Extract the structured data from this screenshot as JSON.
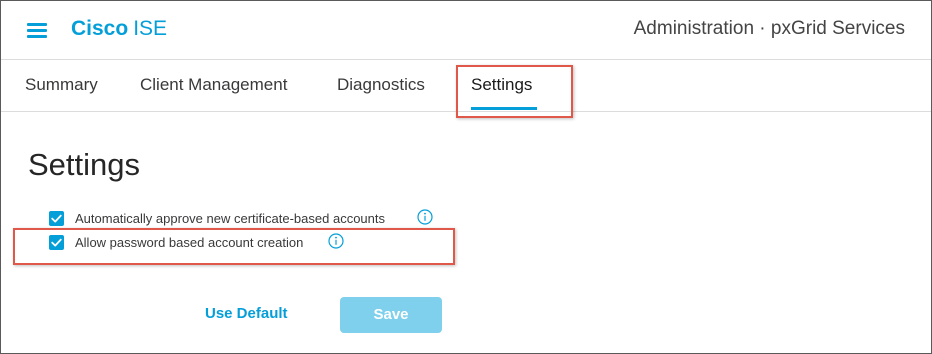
{
  "header": {
    "brand_strong": "Cisco",
    "brand_light": "ISE",
    "title": "Administration · pxGrid Services"
  },
  "tabs": [
    {
      "label": "Summary",
      "active": false
    },
    {
      "label": "Client Management",
      "active": false
    },
    {
      "label": "Diagnostics",
      "active": false
    },
    {
      "label": "Settings",
      "active": true
    }
  ],
  "settings": {
    "title": "Settings",
    "options": [
      {
        "label": "Automatically approve new certificate-based accounts",
        "checked": true,
        "icon": "info-icon"
      },
      {
        "label": "Allow password based account creation",
        "checked": true,
        "icon": "info-icon"
      }
    ]
  },
  "actions": {
    "use_default_label": "Use Default",
    "save_label": "Save",
    "save_enabled": false
  },
  "colors": {
    "accent": "#049fd9",
    "highlight": "#e0584a",
    "save_disabled_bg": "#7fd0ec"
  }
}
